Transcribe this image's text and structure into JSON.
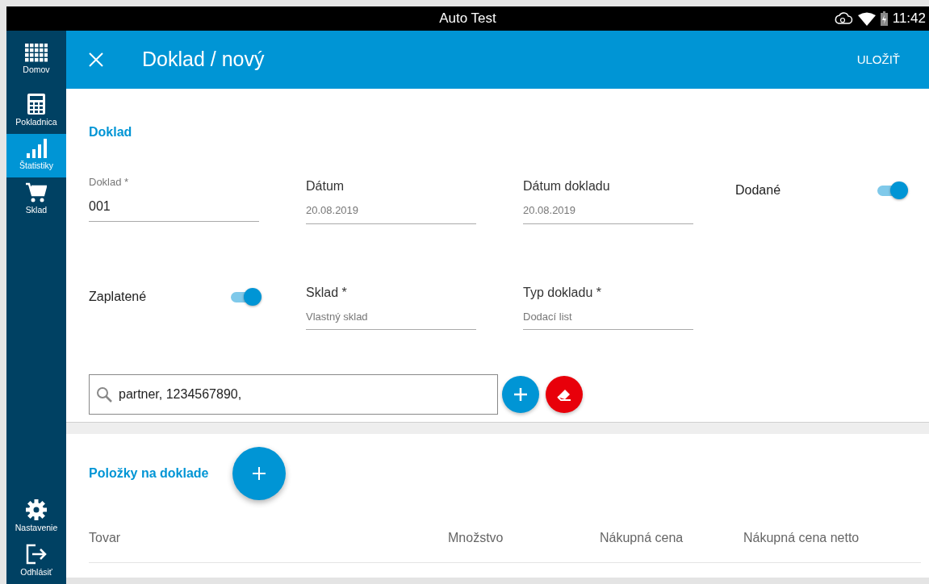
{
  "status_bar": {
    "title": "Auto Test",
    "time": "11:42"
  },
  "sidebar": {
    "items": [
      {
        "label": "Domov",
        "selected": false
      },
      {
        "label": "Pokladnica",
        "selected": false
      },
      {
        "label": "Štatistiky",
        "selected": true
      },
      {
        "label": "Sklad",
        "selected": false
      }
    ],
    "bottom_items": [
      {
        "label": "Nastavenie",
        "selected": false
      },
      {
        "label": "Odhlásiť",
        "selected": false
      }
    ]
  },
  "app_bar": {
    "title": "Doklad / nový",
    "action": "ULOŽIŤ"
  },
  "document": {
    "heading": "Doklad",
    "rows": [
      [
        {
          "kind": "input",
          "label": "Doklad *",
          "value": "001"
        },
        {
          "kind": "picker",
          "label": "Dátum",
          "value": "20.08.2019"
        },
        {
          "kind": "picker",
          "label": "Dátum dokladu",
          "value": "20.08.2019"
        },
        {
          "kind": "toggle",
          "label": "Dodané",
          "on": true
        }
      ],
      [
        {
          "kind": "toggle",
          "label": "Zaplatené",
          "on": true
        },
        {
          "kind": "picker",
          "label": "Sklad *",
          "value": "Vlastný sklad"
        },
        {
          "kind": "picker",
          "label": "Typ dokladu *",
          "value": "Dodací list"
        }
      ]
    ]
  },
  "search": {
    "value": "partner, 1234567890,"
  },
  "items": {
    "heading": "Položky na doklade",
    "columns": [
      "Tovar",
      "Množstvo",
      "Nákupná cena",
      "Nákupná cena netto"
    ]
  }
}
